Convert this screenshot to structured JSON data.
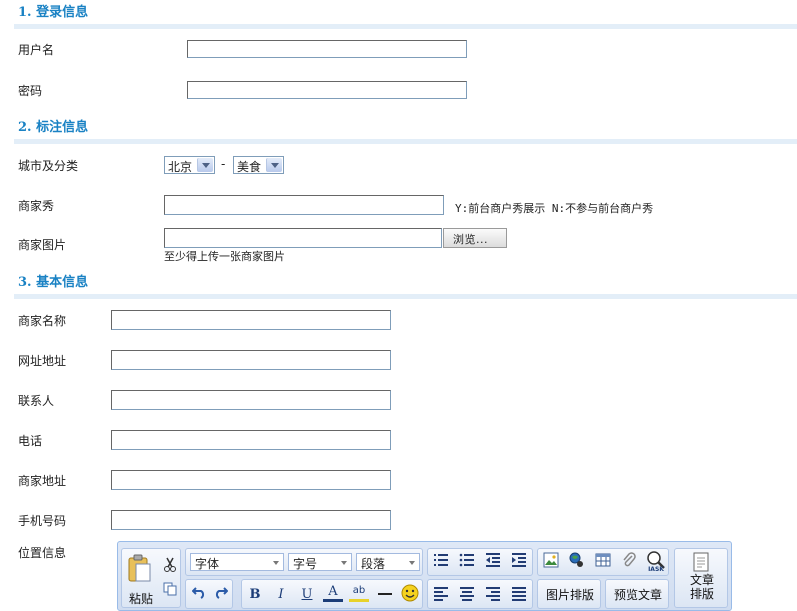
{
  "section1": {
    "title": "1. 登录信息",
    "username_label": "用户名",
    "username_value": "",
    "password_label": "密码",
    "password_value": ""
  },
  "section2": {
    "title": "2. 标注信息",
    "city_label": "城市及分类",
    "city_value": "北京",
    "dash": "-",
    "category_value": "美食",
    "show_label": "商家秀",
    "show_value": "",
    "show_hint": "Y:前台商户秀展示 N:不参与前台商户秀",
    "image_label": "商家图片",
    "image_value": "",
    "browse_label": "浏览...",
    "image_note": "至少得上传一张商家图片"
  },
  "section3": {
    "title": "3. 基本信息",
    "fields": [
      {
        "label": "商家名称",
        "value": ""
      },
      {
        "label": "网址地址",
        "value": ""
      },
      {
        "label": "联系人",
        "value": ""
      },
      {
        "label": "电话",
        "value": ""
      },
      {
        "label": "商家地址",
        "value": ""
      },
      {
        "label": "手机号码",
        "value": ""
      }
    ],
    "location_label": "位置信息"
  },
  "editor": {
    "paste_label": "粘贴",
    "font_value": "字体",
    "size_value": "字号",
    "paragraph_value": "段落",
    "image_layout_label": "图片排版",
    "preview_label": "预览文章",
    "article_layout_label_1": "文章",
    "article_layout_label_2": "排版",
    "bold_glyph": "B",
    "italic_glyph": "I",
    "underline_glyph": "U",
    "fontcolor_glyph": "A",
    "highlight_glyph": "ab",
    "iask_label": "IASK"
  }
}
